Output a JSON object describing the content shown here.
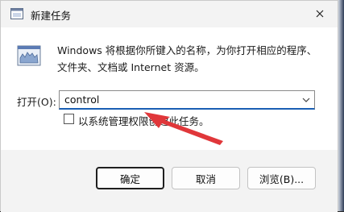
{
  "window": {
    "title": "新建任务"
  },
  "icons": {
    "title_icon": "run-dialog-icon",
    "app_icon": "run-chart-icon",
    "close_icon": "close-icon",
    "combo_arrow": "chevron-down-icon",
    "annotation": "red-arrow-icon"
  },
  "content": {
    "description": "Windows 将根据你所键入的名称，为你打开相应的程序、文件夹、文档或 Internet 资源。",
    "open_label": "打开(O):",
    "open_value": "control",
    "admin_label": "以系统管理权限创建此任务。"
  },
  "buttons": {
    "ok": "确定",
    "cancel": "取消",
    "browse": "浏览(B)..."
  },
  "colors": {
    "accent": "#1a5fb4",
    "annotation_red": "#e0373a"
  }
}
